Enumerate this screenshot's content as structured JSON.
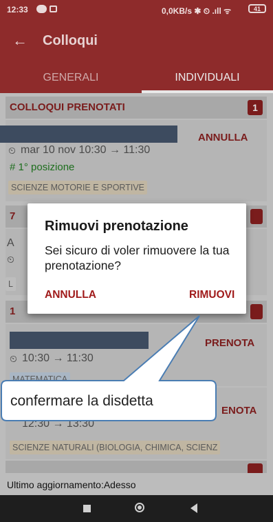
{
  "status_bar": {
    "time": "12:33",
    "right": "0,0KB/s ✱ ⏲ .ıll ᯤ",
    "battery": "41"
  },
  "appbar": {
    "title": "Colloqui"
  },
  "tabs": [
    {
      "label": "GENERALI"
    },
    {
      "label": "INDIVIDUALI"
    }
  ],
  "sections": [
    {
      "header": "COLLOQUI PRENOTATI",
      "count": "1"
    },
    {
      "header": "7",
      "count": ""
    },
    {
      "header": "1",
      "count": ""
    }
  ],
  "booked": {
    "action": "ANNULLA",
    "time": "mar 10 nov 10:30 → 11:30",
    "position": "# 1° posizione",
    "subject": "SCIENZE MOTORIE E SPORTIVE"
  },
  "list2": {
    "line1_prefix": "A",
    "line2_prefix": "",
    "chip_prefix": "L"
  },
  "slot_a": {
    "action": "PRENOTA",
    "time": "10:30 → 11:30",
    "subject": "MATEMATICA"
  },
  "slot_b": {
    "action": "ENOTA",
    "time": "12:30 → 13:30",
    "subject": "SCIENZE NATURALI (BIOLOGIA, CHIMICA, SCIENZ"
  },
  "dialog": {
    "title": "Rimuovi prenotazione",
    "message": "Sei sicuro di voler rimuovere la tua prenotazione?",
    "cancel": "ANNULLA",
    "confirm": "RIMUOVI"
  },
  "callout": {
    "text": "confermare la disdetta"
  },
  "footer": {
    "text": "Ultimo aggiornamento:Adesso"
  },
  "colors": {
    "primary": "#8e2b2b",
    "accent": "#a01b1b",
    "positive": "#1d6e1d",
    "callout_border": "#4a7db3"
  }
}
